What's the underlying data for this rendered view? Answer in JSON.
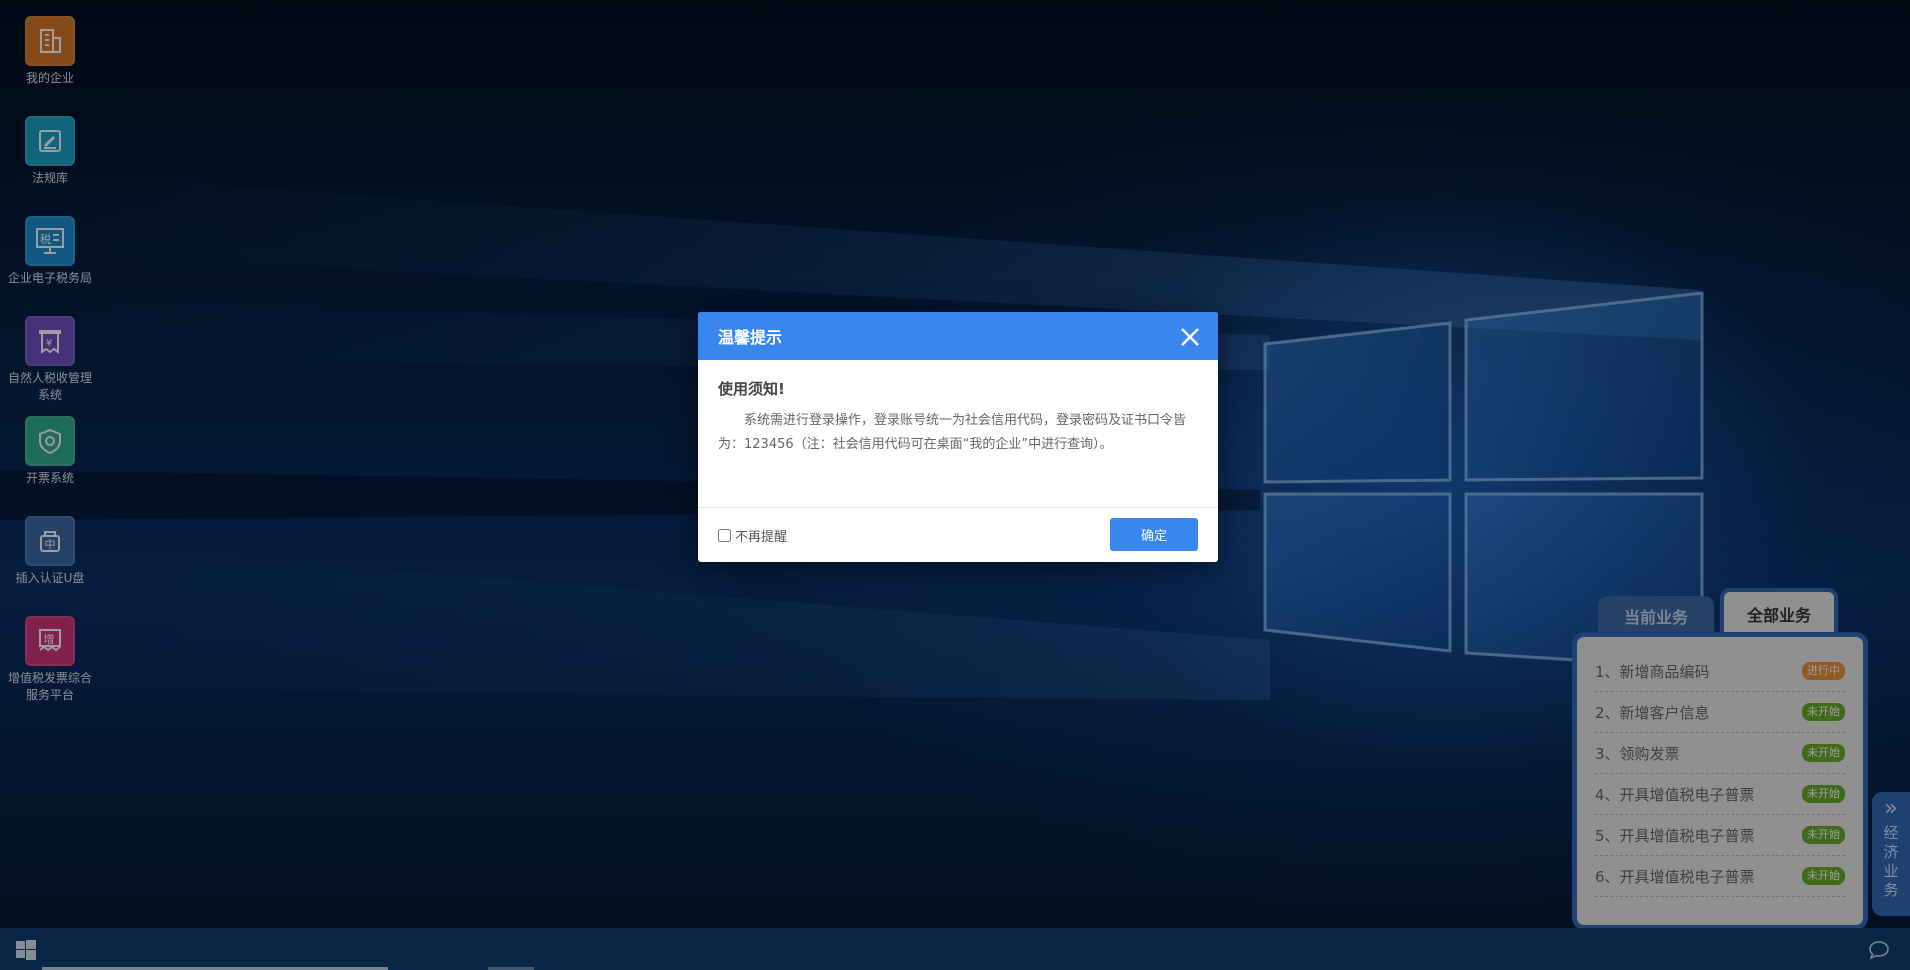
{
  "desktop": {
    "icons": [
      {
        "label": "我的企业",
        "icon": "building-icon",
        "color": "#d9772a"
      },
      {
        "label": "法规库",
        "icon": "gavel-icon",
        "color": "#17a4c9"
      },
      {
        "label": "企业电子税务局",
        "icon": "tax-monitor-icon",
        "color": "#1a8fd1"
      },
      {
        "label": "自然人税收管理系统",
        "icon": "receipt-yen-icon",
        "color": "#6f4fc0"
      },
      {
        "label": "开票系统",
        "icon": "shield-icon",
        "color": "#2fae8f"
      },
      {
        "label": "插入认证U盘",
        "icon": "usb-key-icon",
        "color": "#3b6aa8"
      },
      {
        "label": "增值税发票综合服务平台",
        "icon": "invoice-stamp-icon",
        "color": "#d2357d"
      }
    ]
  },
  "dialog": {
    "title": "温馨提示",
    "heading": "使用须知!",
    "text": "系统需进行登录操作，登录账号统一为社会信用代码，登录密码及证书口令皆为：123456（注：社会信用代码可在桌面“我的企业”中进行查询）。",
    "checkbox_label": "不再提醒",
    "confirm_label": "确定"
  },
  "task_panel": {
    "tabs": [
      {
        "label": "当前业务",
        "active": false
      },
      {
        "label": "全部业务",
        "active": true
      }
    ],
    "items": [
      {
        "label": "1、新增商品编码",
        "status": "进行中",
        "status_color": "#e8913a"
      },
      {
        "label": "2、新增客户信息",
        "status": "未开始",
        "status_color": "#6aaa2a"
      },
      {
        "label": "3、领购发票",
        "status": "未开始",
        "status_color": "#6aaa2a"
      },
      {
        "label": "4、开具增值税电子普票",
        "status": "未开始",
        "status_color": "#6aaa2a"
      },
      {
        "label": "5、开具增值税电子普票",
        "status": "未开始",
        "status_color": "#6aaa2a"
      },
      {
        "label": "6、开具增值税电子普票",
        "status": "未开始",
        "status_color": "#6aaa2a"
      }
    ],
    "side_handle": {
      "chars": [
        "经",
        "济",
        "业",
        "务"
      ],
      "icon": "double-chevron-right-icon"
    }
  },
  "taskbar": {
    "start_icon": "windows-logo-icon",
    "chat_icon": "chat-bubble-icon",
    "color": "#0f3e72"
  },
  "colors": {
    "accent": "#3a86ef",
    "panel_border": "#2f6bb8"
  }
}
